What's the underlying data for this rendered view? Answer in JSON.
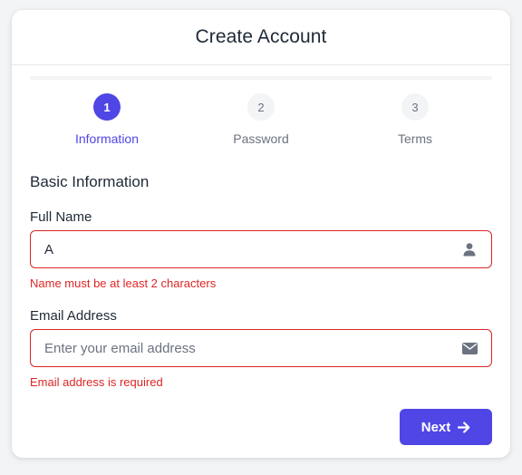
{
  "header": {
    "title": "Create Account"
  },
  "progress": {
    "fraction": 0
  },
  "steps": [
    {
      "number": "1",
      "label": "Information",
      "state": "active"
    },
    {
      "number": "2",
      "label": "Password",
      "state": "inactive"
    },
    {
      "number": "3",
      "label": "Terms",
      "state": "inactive"
    }
  ],
  "form": {
    "section_title": "Basic Information",
    "full_name": {
      "label": "Full Name",
      "value": "A",
      "placeholder": "",
      "icon": "user-icon",
      "error": "Name must be at least 2 characters"
    },
    "email": {
      "label": "Email Address",
      "value": "",
      "placeholder": "Enter your email address",
      "icon": "envelope-icon",
      "error": "Email address is required"
    }
  },
  "actions": {
    "next_label": "Next",
    "next_icon": "arrow-right-icon"
  },
  "colors": {
    "accent": "#4f46e5",
    "error": "#dc2626",
    "text": "#1f2937",
    "muted": "#6b7280"
  }
}
